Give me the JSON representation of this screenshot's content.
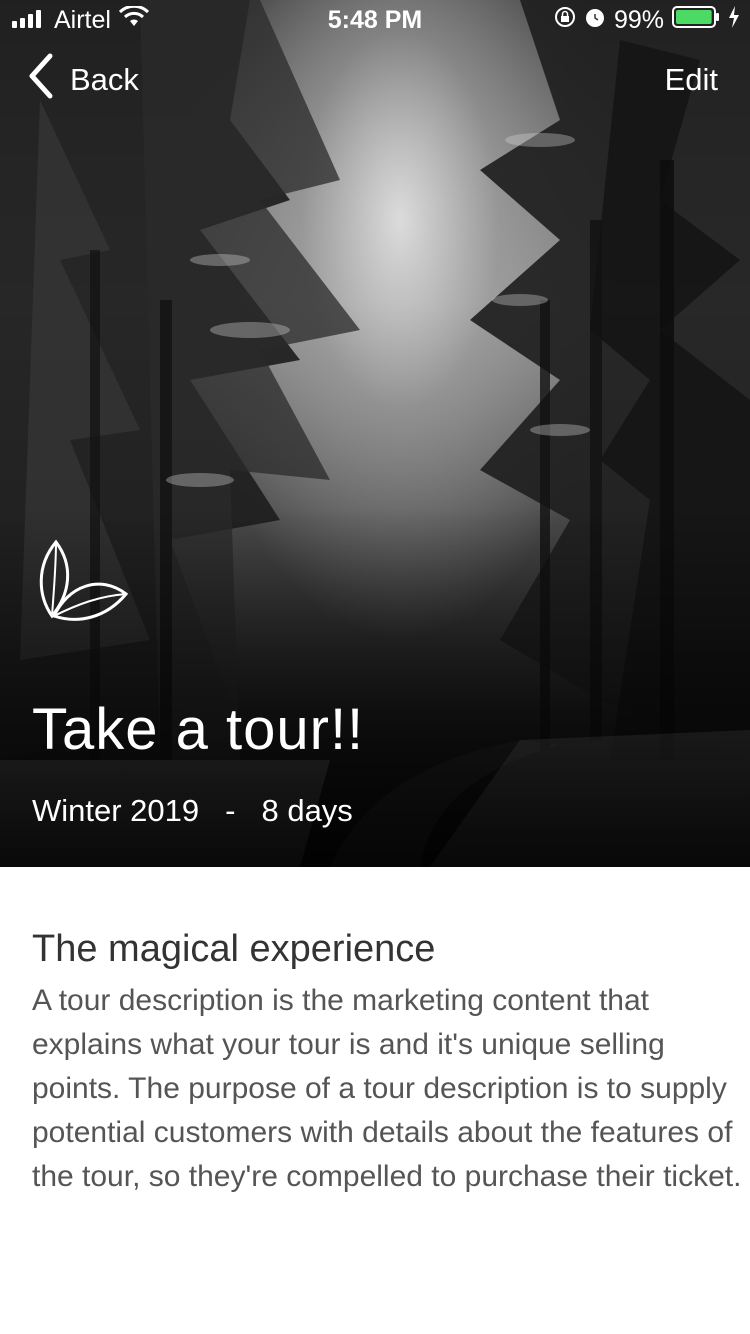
{
  "status_bar": {
    "carrier": "Airtel",
    "time": "5:48 PM",
    "battery_percent": "99%",
    "battery_level": 0.99,
    "signal_icon": "signal-bars-icon",
    "wifi_icon": "wifi-icon",
    "battery_icon": "battery-icon",
    "charging_icon": "charging-bolt-icon",
    "lock_icon": "orientation-lock-icon",
    "alarm_icon": "alarm-icon"
  },
  "nav": {
    "back_label": "Back",
    "edit_label": "Edit",
    "back_icon": "chevron-left-icon"
  },
  "hero": {
    "logo_icon": "leaf-icon",
    "title": "Take a tour!!",
    "season": "Winter 2019",
    "separator": "-",
    "duration": "8 days"
  },
  "content": {
    "section_title": "The magical experience",
    "description": "A tour description is the marketing content that explains what your tour is and it's unique selling points. The purpose of a tour description is to supply potential customers with details about the features of the tour, so they're compelled to purchase their ticket."
  },
  "colors": {
    "battery_green": "#4cd964",
    "text_dark": "#333333",
    "text_body": "#555555"
  }
}
